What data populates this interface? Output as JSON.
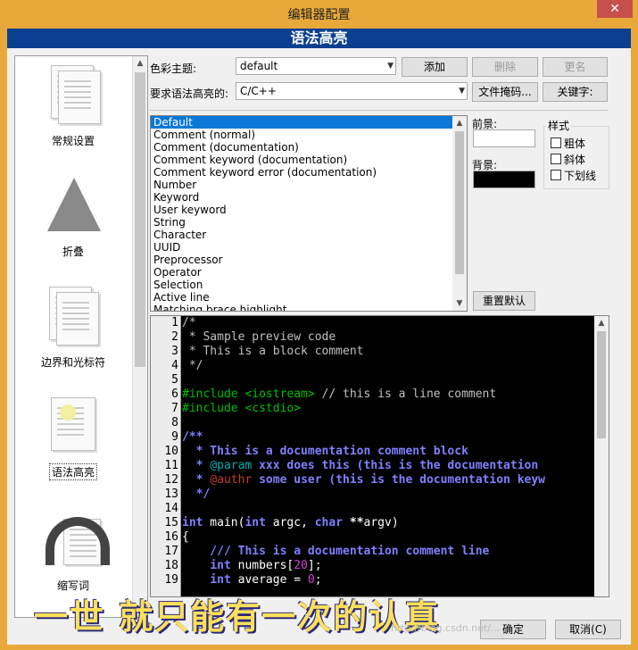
{
  "window": {
    "title": "编辑器配置",
    "close_glyph": "✕"
  },
  "banner": {
    "text": "语法高亮"
  },
  "sidebar": {
    "items": [
      {
        "label": "常规设置"
      },
      {
        "label": "折叠"
      },
      {
        "label": "边界和光标符"
      },
      {
        "label": "语法高亮"
      },
      {
        "label": "缩写词"
      }
    ]
  },
  "color_theme": {
    "label": "色彩主题:",
    "value": "default",
    "add": "添加",
    "delete": "删除",
    "rename": "更名"
  },
  "lang": {
    "label": "要求语法高亮的:",
    "value": "C/C++",
    "file_masks": "文件掩码...",
    "keywords": "关键字:"
  },
  "styles_list": [
    "Default",
    "Comment (normal)",
    "Comment (documentation)",
    "Comment keyword (documentation)",
    "Comment keyword error (documentation)",
    "Number",
    "Keyword",
    "User keyword",
    "String",
    "Character",
    "UUID",
    "Preprocessor",
    "Operator",
    "Selection",
    "Active line",
    "Matching brace highlight"
  ],
  "foreground": {
    "label": "前景:",
    "color": "#ffffff"
  },
  "background": {
    "label": "背景:",
    "color": "#000000"
  },
  "style_group": {
    "title": "样式",
    "bold": "粗体",
    "italic": "斜体",
    "underline": "下划线"
  },
  "reset_defaults": "重置默认",
  "line_numbers": [
    "1",
    "2",
    "3",
    "4",
    "5",
    "6",
    "7",
    "8",
    "9",
    "10",
    "11",
    "12",
    "13",
    "14",
    "15",
    "16",
    "17",
    "18",
    "19"
  ],
  "code": {
    "l1": "/*",
    "l2": " * Sample preview code",
    "l3": " * This is a block comment",
    "l4": " */",
    "l6a": "#include <iostream>",
    "l6b": " // this is a line comment",
    "l7": "#include <cstdio>",
    "l9": "/**",
    "l10": "  * This is a documentation comment block",
    "l11a": "  * ",
    "l11b": "@param",
    "l11c": " xxx does this (this is the documentation",
    "l12a": "  * ",
    "l12b": "@authr",
    "l12c": " some user (this is the documentation keyw",
    "l13": "  */",
    "l15a": "int",
    "l15b": " main(",
    "l15c": "int",
    "l15d": " argc, ",
    "l15e": "char",
    "l15f": " **",
    "l15g": "argv)",
    "l16": "{",
    "l17": "    /// This is a documentation comment line",
    "l18a": "    ",
    "l18b": "int",
    "l18c": " numbers[",
    "l18d": "20",
    "l18e": "];",
    "l19a": "    ",
    "l19b": "int",
    "l19c": " average = ",
    "l19d": "0",
    "l19e": ";"
  },
  "footer": {
    "ok": "确定",
    "cancel": "取消(C)"
  },
  "overlay": {
    "motto": "一世 就只能有一次的认真",
    "watermark": "http://blog.csdn.net/..."
  }
}
